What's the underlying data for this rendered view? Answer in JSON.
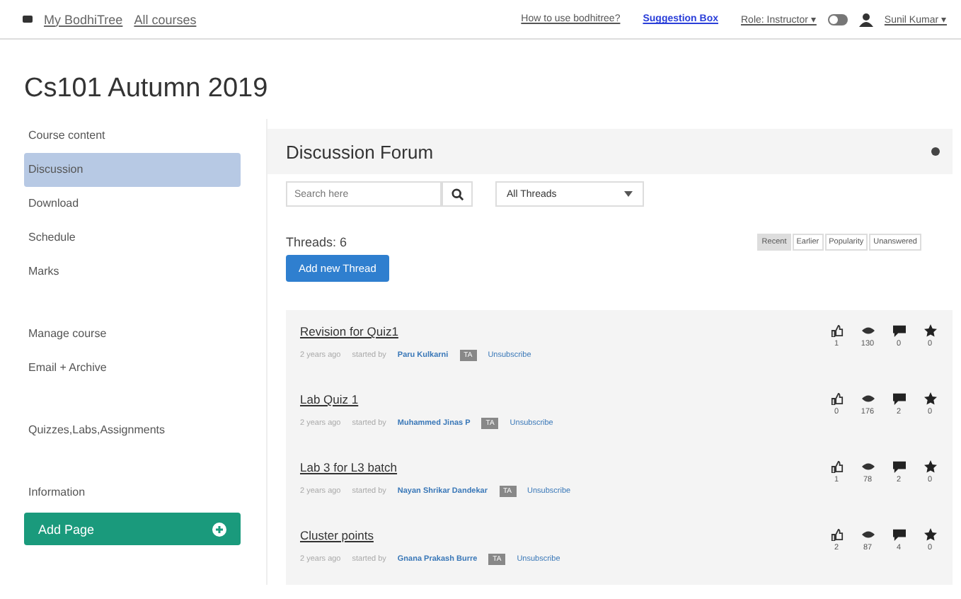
{
  "topbar": {
    "home": "My BodhiTree",
    "courses": "All courses",
    "help": "How to use bodhitree?",
    "suggestion": "Suggestion Box",
    "role": "Role: Instructor ▾",
    "user": "Sunil Kumar ▾",
    "toggle": {
      "on": false
    }
  },
  "course_title": "Cs101 Autumn 2019",
  "sidebar": {
    "items": [
      {
        "label": "Course content",
        "selected": false,
        "kind": "header"
      },
      {
        "label": "Discussion",
        "selected": true,
        "kind": "link"
      },
      {
        "label": "Download",
        "selected": false,
        "kind": "link"
      },
      {
        "label": "Schedule",
        "selected": false,
        "kind": "link"
      },
      {
        "label": "Marks",
        "selected": false,
        "kind": "link"
      },
      {
        "label": "Manage course",
        "selected": false,
        "kind": "header"
      },
      {
        "label": "Email + Archive",
        "selected": false,
        "kind": "link"
      },
      {
        "label": "Quizzes,Labs,Assignments",
        "selected": false,
        "kind": "header"
      },
      {
        "label": "Information",
        "selected": false,
        "kind": "header"
      }
    ],
    "add_page": "Add Page"
  },
  "forum": {
    "title": "Discussion Forum",
    "search": {
      "placeholder": "Search here"
    },
    "filter": "All Threads",
    "count": "Threads: 6",
    "add_button": "Add new Thread",
    "sort": [
      {
        "label": "Recent",
        "selected": true
      },
      {
        "label": "Earlier",
        "selected": false
      },
      {
        "label": "Popularity",
        "selected": false
      },
      {
        "label": "Unanswered",
        "selected": false
      }
    ],
    "threads": [
      {
        "title": "Revision for Quiz1",
        "age": "2 years ago",
        "started": "started by",
        "author": "Paru Kulkarni",
        "badge": "TA",
        "action": "Unsubscribe",
        "likes": "1",
        "views": "130",
        "replies": "0",
        "stars": "0"
      },
      {
        "title": "Lab Quiz 1",
        "age": "2 years ago",
        "started": "started by",
        "author": "Muhammed Jinas P",
        "badge": "TA",
        "action": "Unsubscribe",
        "likes": "0",
        "views": "176",
        "replies": "2",
        "stars": "0"
      },
      {
        "title": "Lab 3 for L3 batch",
        "age": "2 years ago",
        "started": "started by",
        "author": "Nayan Shrikar Dandekar",
        "badge": "TA",
        "action": "Unsubscribe",
        "likes": "1",
        "views": "78",
        "replies": "2",
        "stars": "0"
      },
      {
        "title": "Cluster points",
        "age": "2 years ago",
        "started": "started by",
        "author": "Gnana Prakash Burre",
        "badge": "TA",
        "action": "Unsubscribe",
        "likes": "2",
        "views": "87",
        "replies": "4",
        "stars": "0"
      }
    ]
  }
}
